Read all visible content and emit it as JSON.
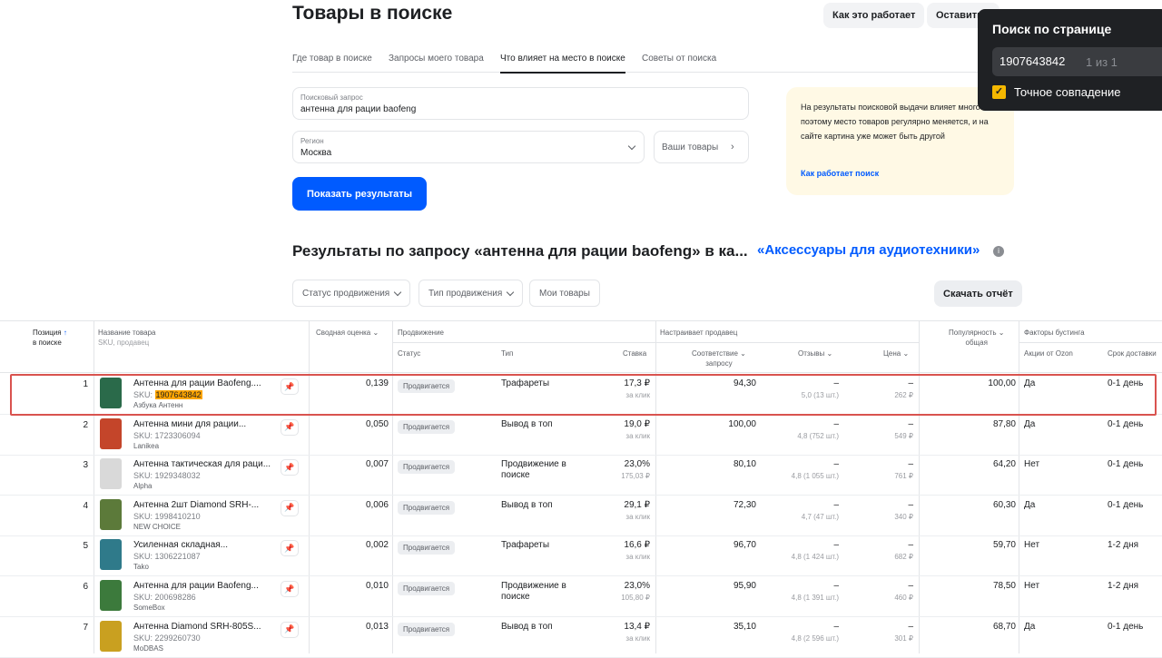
{
  "header": {
    "title": "Товары в поиске",
    "how_btn": "Как это работает",
    "leave_btn": "Оставить"
  },
  "tabs": [
    "Где товар в поиске",
    "Запросы моего товара",
    "Что влияет на место в поиске",
    "Советы от поиска"
  ],
  "search": {
    "label": "Поисковый запрос",
    "value": "антенна для рации baofeng"
  },
  "region": {
    "label": "Регион",
    "value": "Москва"
  },
  "your_goods": "Ваши товары",
  "show_btn": "Показать результаты",
  "info": {
    "text": "На результаты поисковой выдачи влияет многое — поэтому место товаров регулярно меняется, и на сайте картина уже может быть другой",
    "link": "Как работает поиск"
  },
  "results": {
    "title": "Результаты по запросу «антенна для рации baofeng» в ка...",
    "category": "«Аксессуары для аудиотехники»"
  },
  "filters": {
    "status": "Статус продвижения",
    "type": "Тип продвижения",
    "mine": "Мои товары",
    "download": "Скачать отчёт"
  },
  "table": {
    "h_pos": "Позиция",
    "h_pos2": "в поиске",
    "h_name": "Название товара",
    "h_name_sub": "SKU, продавец",
    "h_score": "Сводная оценка",
    "h_promo": "Продвижение",
    "h_status": "Статус",
    "h_type": "Тип",
    "h_rate": "Ставка",
    "h_seller": "Настраивает продавец",
    "h_match": "Соответствие",
    "h_match2": "запросу",
    "h_reviews": "Отзывы",
    "h_price": "Цена",
    "h_pop": "Популярность",
    "h_pop2": "общая",
    "h_boost": "Факторы бустинга",
    "h_ozon": "Акции от Ozon",
    "h_delivery": "Срок доставки",
    "rows": [
      {
        "pos": "1",
        "name": "Антенна для рации Baofeng....",
        "sku_label": "SKU:",
        "sku": "1907643842",
        "seller": "Азбука Антенн",
        "score": "0,139",
        "status": "Продвигается",
        "type": "Трафареты",
        "rate": "17,3 ₽",
        "rate_sub": "за клик",
        "match": "94,30",
        "rev": "–",
        "rev_sub": "5,0 (13 шт.)",
        "price": "–",
        "price_sub": "262 ₽",
        "pop": "100,00",
        "ozon": "Да",
        "deliv": "0-1 день",
        "color": "#2a6a4a"
      },
      {
        "pos": "2",
        "name": "Антенна мини для рации...",
        "sku_label": "SKU:",
        "sku": "1723306094",
        "seller": "Lanikea",
        "score": "0,050",
        "status": "Продвигается",
        "type": "Вывод в топ",
        "rate": "19,0 ₽",
        "rate_sub": "за клик",
        "match": "100,00",
        "rev": "–",
        "rev_sub": "4,8 (752 шт.)",
        "price": "–",
        "price_sub": "549 ₽",
        "pop": "87,80",
        "ozon": "Да",
        "deliv": "0-1 день",
        "color": "#c4452a"
      },
      {
        "pos": "3",
        "name": "Антенна тактическая для раци...",
        "sku_label": "SKU:",
        "sku": "1929348032",
        "seller": "Alpha",
        "score": "0,007",
        "status": "Продвигается",
        "type": "Продвижение в поиске",
        "rate": "23,0%",
        "rate_sub": "175,03 ₽",
        "match": "80,10",
        "rev": "–",
        "rev_sub": "4,8 (1 055 шт.)",
        "price": "–",
        "price_sub": "761 ₽",
        "pop": "64,20",
        "ozon": "Нет",
        "deliv": "0-1 день",
        "color": "#d9d9d9"
      },
      {
        "pos": "4",
        "name": "Антенна 2шт Diamond SRH-...",
        "sku_label": "SKU:",
        "sku": "1998410210",
        "seller": "NEW CHOICE",
        "score": "0,006",
        "status": "Продвигается",
        "type": "Вывод в топ",
        "rate": "29,1 ₽",
        "rate_sub": "за клик",
        "match": "72,30",
        "rev": "–",
        "rev_sub": "4,7 (47 шт.)",
        "price": "–",
        "price_sub": "340 ₽",
        "pop": "60,30",
        "ozon": "Да",
        "deliv": "0-1 день",
        "color": "#5c7a3a"
      },
      {
        "pos": "5",
        "name": "Усиленная складная...",
        "sku_label": "SKU:",
        "sku": "1306221087",
        "seller": "Tako",
        "score": "0,002",
        "status": "Продвигается",
        "type": "Трафареты",
        "rate": "16,6 ₽",
        "rate_sub": "за клик",
        "match": "96,70",
        "rev": "–",
        "rev_sub": "4,8 (1 424 шт.)",
        "price": "–",
        "price_sub": "682 ₽",
        "pop": "59,70",
        "ozon": "Нет",
        "deliv": "1-2 дня",
        "color": "#2f7a8a"
      },
      {
        "pos": "6",
        "name": "Антенна для рации Baofeng...",
        "sku_label": "SKU:",
        "sku": "200698286",
        "seller": "SomeBox",
        "score": "0,010",
        "status": "Продвигается",
        "type": "Продвижение в поиске",
        "rate": "23,0%",
        "rate_sub": "105,80 ₽",
        "match": "95,90",
        "rev": "–",
        "rev_sub": "4,8 (1 391 шт.)",
        "price": "–",
        "price_sub": "460 ₽",
        "pop": "78,50",
        "ozon": "Нет",
        "deliv": "1-2 дня",
        "color": "#3c7a3c"
      },
      {
        "pos": "7",
        "name": "Антенна Diamond SRH-805S...",
        "sku_label": "SKU:",
        "sku": "2299260730",
        "seller": "MoDBAS",
        "score": "0,013",
        "status": "Продвигается",
        "type": "Вывод в топ",
        "rate": "13,4 ₽",
        "rate_sub": "за клик",
        "match": "35,10",
        "rev": "–",
        "rev_sub": "4,8 (2 596 шт.)",
        "price": "–",
        "price_sub": "301 ₽",
        "pop": "68,70",
        "ozon": "Да",
        "deliv": "0-1 день",
        "color": "#c9a020"
      }
    ]
  },
  "find": {
    "title": "Поиск по странице",
    "query": "1907643842",
    "count": "1 из 1",
    "exact": "Точное совпадение"
  },
  "colors": {
    "accent": "#005bff",
    "highlight": "#ffa500",
    "frame": "#d9534f"
  }
}
